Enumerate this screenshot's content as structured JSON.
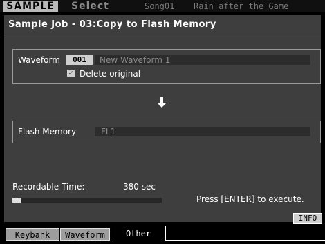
{
  "header": {
    "mode": "SAMPLE",
    "submode": "Select",
    "song_number": "Song01",
    "song_name": "Rain after the Game"
  },
  "job": {
    "title": "Sample Job - 03:Copy to Flash Memory"
  },
  "waveform": {
    "label": "Waveform",
    "number": "001",
    "name": "New Waveform 1",
    "delete_label": "Delete original",
    "delete_checked": true,
    "check_glyph": "✓"
  },
  "arrow_icon": "arrow-down",
  "flash": {
    "label": "Flash Memory",
    "value": "FL1"
  },
  "recordable": {
    "label": "Recordable Time:",
    "value": "380 sec",
    "fill_fraction": 0.06
  },
  "execute_hint": "Press [ENTER] to execute.",
  "info_button": "INFO",
  "tabs": [
    {
      "label": "Keybank",
      "active": false
    },
    {
      "label": "Waveform",
      "active": false
    },
    {
      "label": "Other",
      "active": true
    }
  ]
}
